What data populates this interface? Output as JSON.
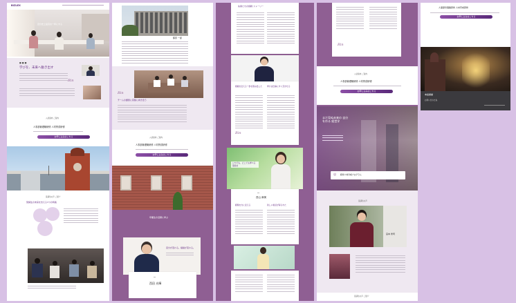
{
  "brand": {
    "logo_text": "BIZLEX"
  },
  "col1": {
    "hero_caption": "自分史上最高の一年にする",
    "section_title": "学びを、未来へ動き出す",
    "signature": "Rin",
    "intro_heading": "入試案内 ご案内",
    "program_title": "人事部管理職研修 人材育成研修",
    "enroll_label": "お申し込みはこちら",
    "tower_heading": "受講生の声 ご紹介",
    "bubble_heading": "受講生の未来を支える3つの特長"
  },
  "col2": {
    "name_tag": "藤原 一郎",
    "quote": "チームの課題に真摯に向き合う",
    "program_heading": "入試案内 ご案内",
    "program_title": "人事部管理職研修 人材育成研修",
    "enroll_label": "お申し込みはこちら",
    "brick_caption": "卒業生の活躍に学ぶ",
    "portrait_caption": "自分が変わる。組織が変わる。",
    "portrait_name": "西田 光輝"
  },
  "col3": {
    "story_title": "先輩たちの挑戦 ストーリー",
    "quote_a": "組織を変える一歩を踏み出した",
    "quote_b": "学びは仕事にすぐ活かせる",
    "signature": "Rin",
    "hero_banner": "いつでも、どこでも学べる環境を",
    "profile_name": "西山 麻美",
    "quote_c": "経験を力に変える",
    "quote_d": "新しい視点が得られた"
  },
  "col4": {
    "signature": "Rin",
    "program_heading": "入試案内 ご案内",
    "program_title": "人事部管理職研修 人材育成研修",
    "enroll_label": "お申し込みはこちら",
    "overlay_text": "まだ見ぬ未来の 自分を作る 経営学",
    "badge_text": "経営人材育成プログラム",
    "alumni_heading": "受講生の声",
    "alumni_name": "宮本 修司",
    "footer_heading": "受講生の声 ご紹介"
  },
  "col5": {
    "program_title": "人事部管理職研修 人材育成研修",
    "enroll_label": "お申し込みはこちら",
    "night_caption": "本館講堂",
    "night_footer": "お問い合わせ先"
  },
  "colors": {
    "purple": "#8f5f93",
    "lavender": "#d8c1e5",
    "button": "#6b3488"
  }
}
